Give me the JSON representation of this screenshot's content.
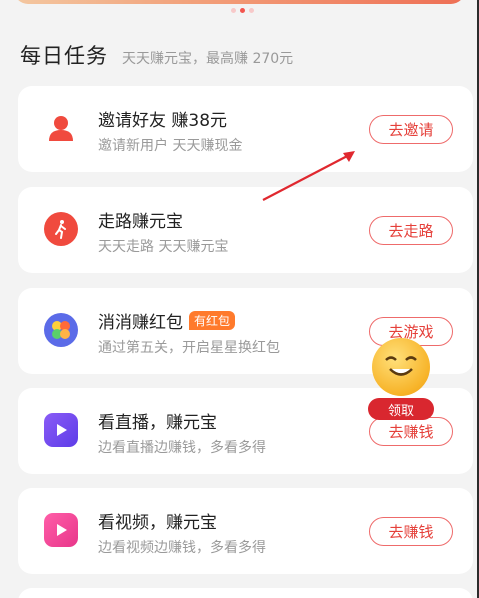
{
  "carousel": {
    "dot_count": 3,
    "active_index": 1
  },
  "section": {
    "title": "每日任务",
    "subtitle": "天天赚元宝，最高赚 270元"
  },
  "tasks": [
    {
      "title": "邀请好友 赚38元",
      "desc": "邀请新用户 天天赚现金",
      "button": "去邀请",
      "icon": "user-icon",
      "color": "#f04a3e"
    },
    {
      "title": "走路赚元宝",
      "desc": "天天走路 天天赚元宝",
      "button": "去走路",
      "icon": "walking-icon",
      "color": "#f04a3e"
    },
    {
      "title": "消消赚红包",
      "badge": "有红包",
      "desc": "通过第五关，开启星星换红包",
      "button": "去游戏",
      "icon": "game-icon",
      "color": "#5b6be8"
    },
    {
      "title": "看直播，赚元宝",
      "desc": "边看直播边赚钱，多看多得",
      "button": "去赚钱",
      "icon": "play-icon",
      "color": "#7a4ef0"
    },
    {
      "title": "看视频，赚元宝",
      "desc": "边看视频边赚钱，多看多得",
      "button": "去赚钱",
      "icon": "video-play-icon",
      "color": "#f2479a"
    }
  ],
  "mascot": {
    "label": "领取"
  }
}
